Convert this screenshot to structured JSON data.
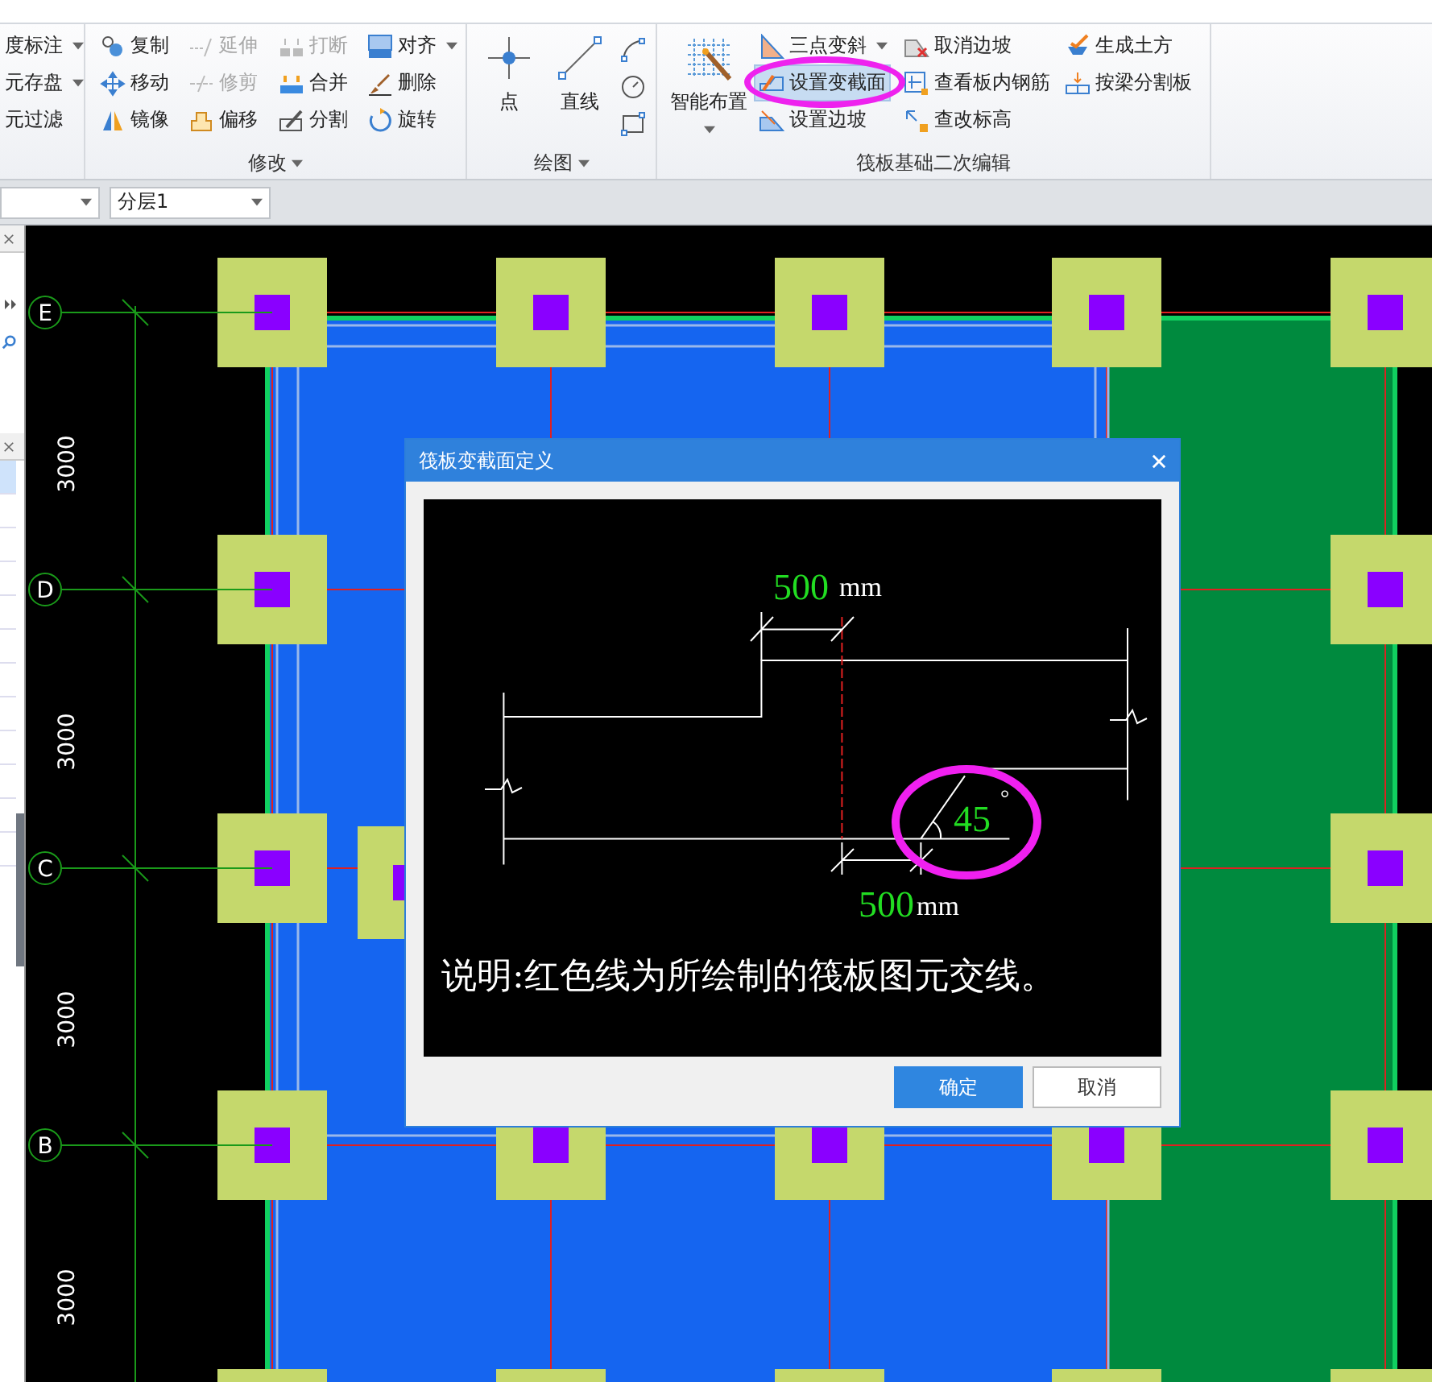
{
  "ribbon": {
    "groups": [
      {
        "columns": [
          [
            {
              "label": "度标注",
              "menu": true
            },
            {
              "label": "元存盘",
              "menu": true
            },
            {
              "label": "元过滤",
              "menu": false
            }
          ]
        ]
      },
      {
        "label": "修改",
        "menu": true,
        "columns": [
          [
            {
              "label": "复制",
              "disabled": false
            },
            {
              "label": "移动",
              "disabled": false
            },
            {
              "label": "镜像",
              "disabled": false
            }
          ],
          [
            {
              "label": "延伸",
              "disabled": true
            },
            {
              "label": "修剪",
              "disabled": true
            },
            {
              "label": "偏移",
              "disabled": false
            }
          ],
          [
            {
              "label": "打断",
              "disabled": true
            },
            {
              "label": "合并",
              "disabled": false
            },
            {
              "label": "分割",
              "disabled": false
            }
          ],
          [
            {
              "label": "对齐",
              "disabled": false,
              "menu": true
            },
            {
              "label": "删除",
              "disabled": false
            },
            {
              "label": "旋转",
              "disabled": false
            }
          ]
        ]
      },
      {
        "label": "绘图",
        "menu": true,
        "large": [
          {
            "label": "点"
          },
          {
            "label": "直线"
          }
        ]
      },
      {
        "label": "筏板基础二次编辑",
        "menu": false,
        "large": [
          {
            "label": "智能布置",
            "menu": true
          }
        ],
        "columns": [
          [
            {
              "label": "三点变斜",
              "menu": true,
              "selected": false
            },
            {
              "label": "设置变截面",
              "selected": true
            },
            {
              "label": "设置边坡",
              "selected": false
            }
          ],
          [
            {
              "label": "取消边坡",
              "selected": false
            },
            {
              "label": "查看板内钢筋",
              "selected": false
            },
            {
              "label": "查改标高",
              "selected": false
            }
          ],
          [
            {
              "label": "生成土方",
              "selected": false
            },
            {
              "label": "按梁分割板",
              "selected": false
            }
          ]
        ]
      }
    ]
  },
  "toolbar": {
    "dropdowns": [
      {
        "kind": "dropdown"
      },
      {
        "kind": "dropdown",
        "value": "分层1"
      }
    ]
  },
  "side_panel": {
    "rows": [
      {
        "selected": true
      },
      {
        "selected": false
      },
      {
        "selected": false
      },
      {
        "selected": false
      },
      {
        "selected": false
      },
      {
        "selected": false
      },
      {
        "selected": false
      },
      {
        "selected": false
      },
      {
        "selected": false
      },
      {
        "selected": false
      },
      {
        "selected": false
      },
      {
        "selected": false
      }
    ]
  },
  "canvas": {
    "axes": [
      {
        "label": "E"
      },
      {
        "label": "D"
      },
      {
        "label": "C"
      },
      {
        "label": "B"
      }
    ],
    "spacings": [
      "3000",
      "3000",
      "3000",
      "3000"
    ]
  },
  "dialog": {
    "title": "筏板变截面定义",
    "top_dimension": {
      "value": "500",
      "unit": "mm"
    },
    "angle": {
      "value": "45",
      "unit": "°"
    },
    "bottom_dimension": {
      "value": "500",
      "unit": "mm"
    },
    "note": "说明:红色线为所绘制的筏板图元交线。",
    "buttons": [
      {
        "label": "确定",
        "primary": true
      },
      {
        "label": "取消",
        "primary": false
      }
    ]
  }
}
